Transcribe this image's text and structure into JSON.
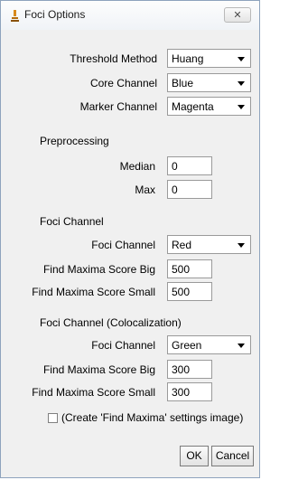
{
  "window": {
    "title": "Foci Options",
    "close_glyph": "✕"
  },
  "settings": {
    "threshold_method": {
      "label": "Threshold Method",
      "value": "Huang"
    },
    "core_channel": {
      "label": "Core Channel",
      "value": "Blue"
    },
    "marker_channel": {
      "label": "Marker Channel",
      "value": "Magenta"
    }
  },
  "preprocessing": {
    "heading": "Preprocessing",
    "median": {
      "label": "Median",
      "value": "0"
    },
    "max": {
      "label": "Max",
      "value": "0"
    }
  },
  "foci": {
    "heading": "Foci Channel",
    "channel": {
      "label": "Foci Channel",
      "value": "Red"
    },
    "score_big": {
      "label": "Find Maxima Score Big",
      "value": "500"
    },
    "score_small": {
      "label": "Find Maxima Score Small",
      "value": "500"
    }
  },
  "coloc": {
    "heading": "Foci Channel (Colocalization)",
    "channel": {
      "label": "Foci Channel",
      "value": "Green"
    },
    "score_big": {
      "label": "Find Maxima Score Big",
      "value": "300"
    },
    "score_small": {
      "label": "Find Maxima Score Small",
      "value": "300"
    }
  },
  "checkbox": {
    "label": "(Create 'Find Maxima' settings image)",
    "checked": false
  },
  "buttons": {
    "ok": "OK",
    "cancel": "Cancel"
  },
  "icons": {
    "app": "microscope-icon",
    "close": "close-icon",
    "dropdown": "chevron-down-icon"
  }
}
